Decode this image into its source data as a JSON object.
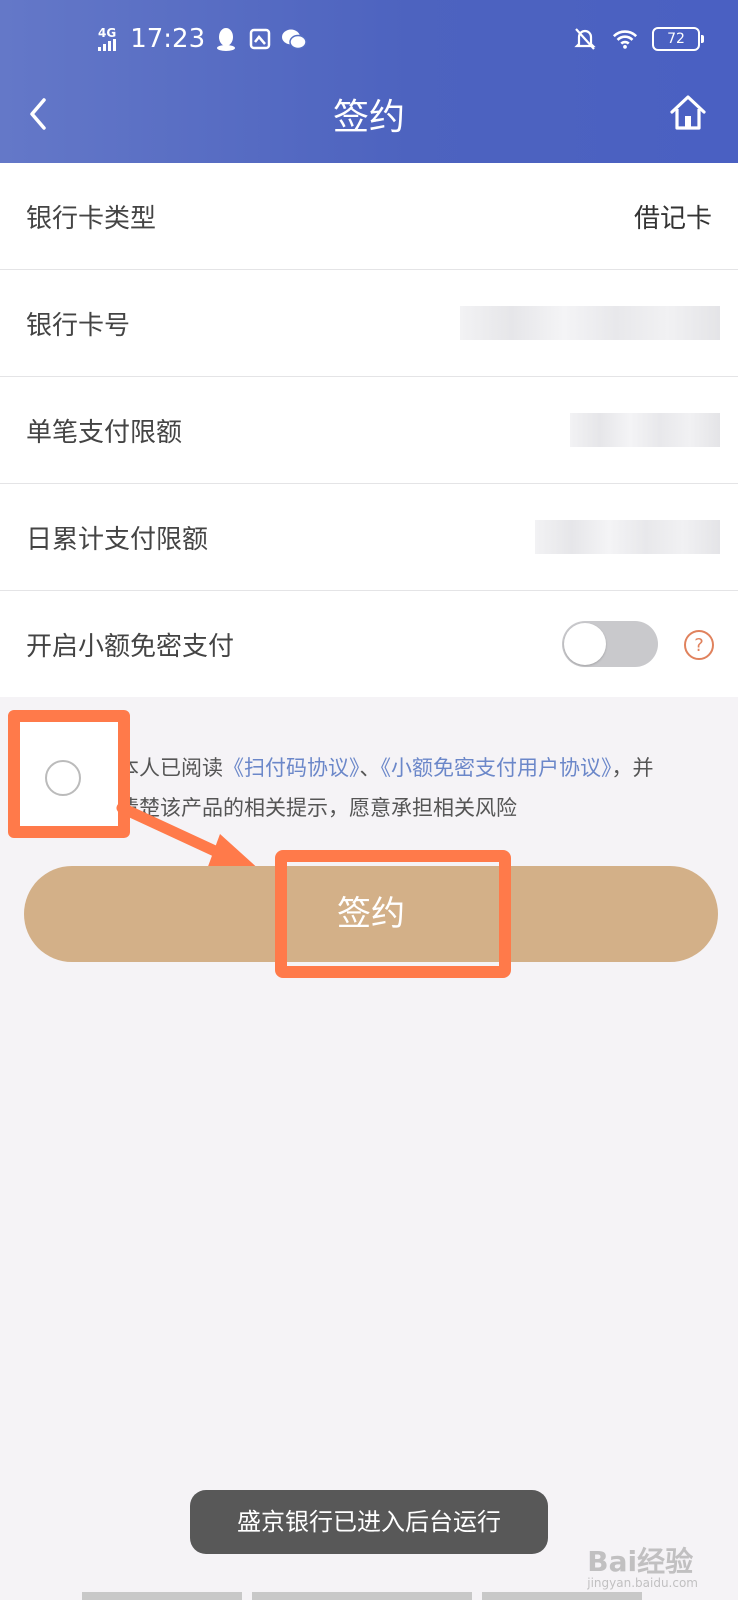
{
  "status_bar": {
    "network": "4G",
    "time": "17:23",
    "battery": "72"
  },
  "header": {
    "title": "签约"
  },
  "list": {
    "card_type_label": "银行卡类型",
    "card_type_value": "借记卡",
    "card_number_label": "银行卡号",
    "single_limit_label": "单笔支付限额",
    "daily_limit_label": "日累计支付限额",
    "small_amount_label": "开启小额免密支付",
    "small_amount_enabled": false,
    "help_symbol": "?"
  },
  "agreement": {
    "prefix": "本人已阅读",
    "link1": "《扫付码协议》",
    "separator": "、",
    "link2": "《小额免密支付用户协议》",
    "suffix": "，并清楚该产品的相关提示，愿意承担相关风险"
  },
  "sign_button": {
    "label": "签约"
  },
  "toast": {
    "text": "盛京银行已进入后台运行"
  },
  "watermark": {
    "text": "Bai经验",
    "sub": "jingyan.baidu.com"
  },
  "colors": {
    "header_start": "#6478c8",
    "header_end": "#4a60c2",
    "button": "#d3b088",
    "highlight": "#ff7a4a",
    "link": "#6b87c9"
  }
}
